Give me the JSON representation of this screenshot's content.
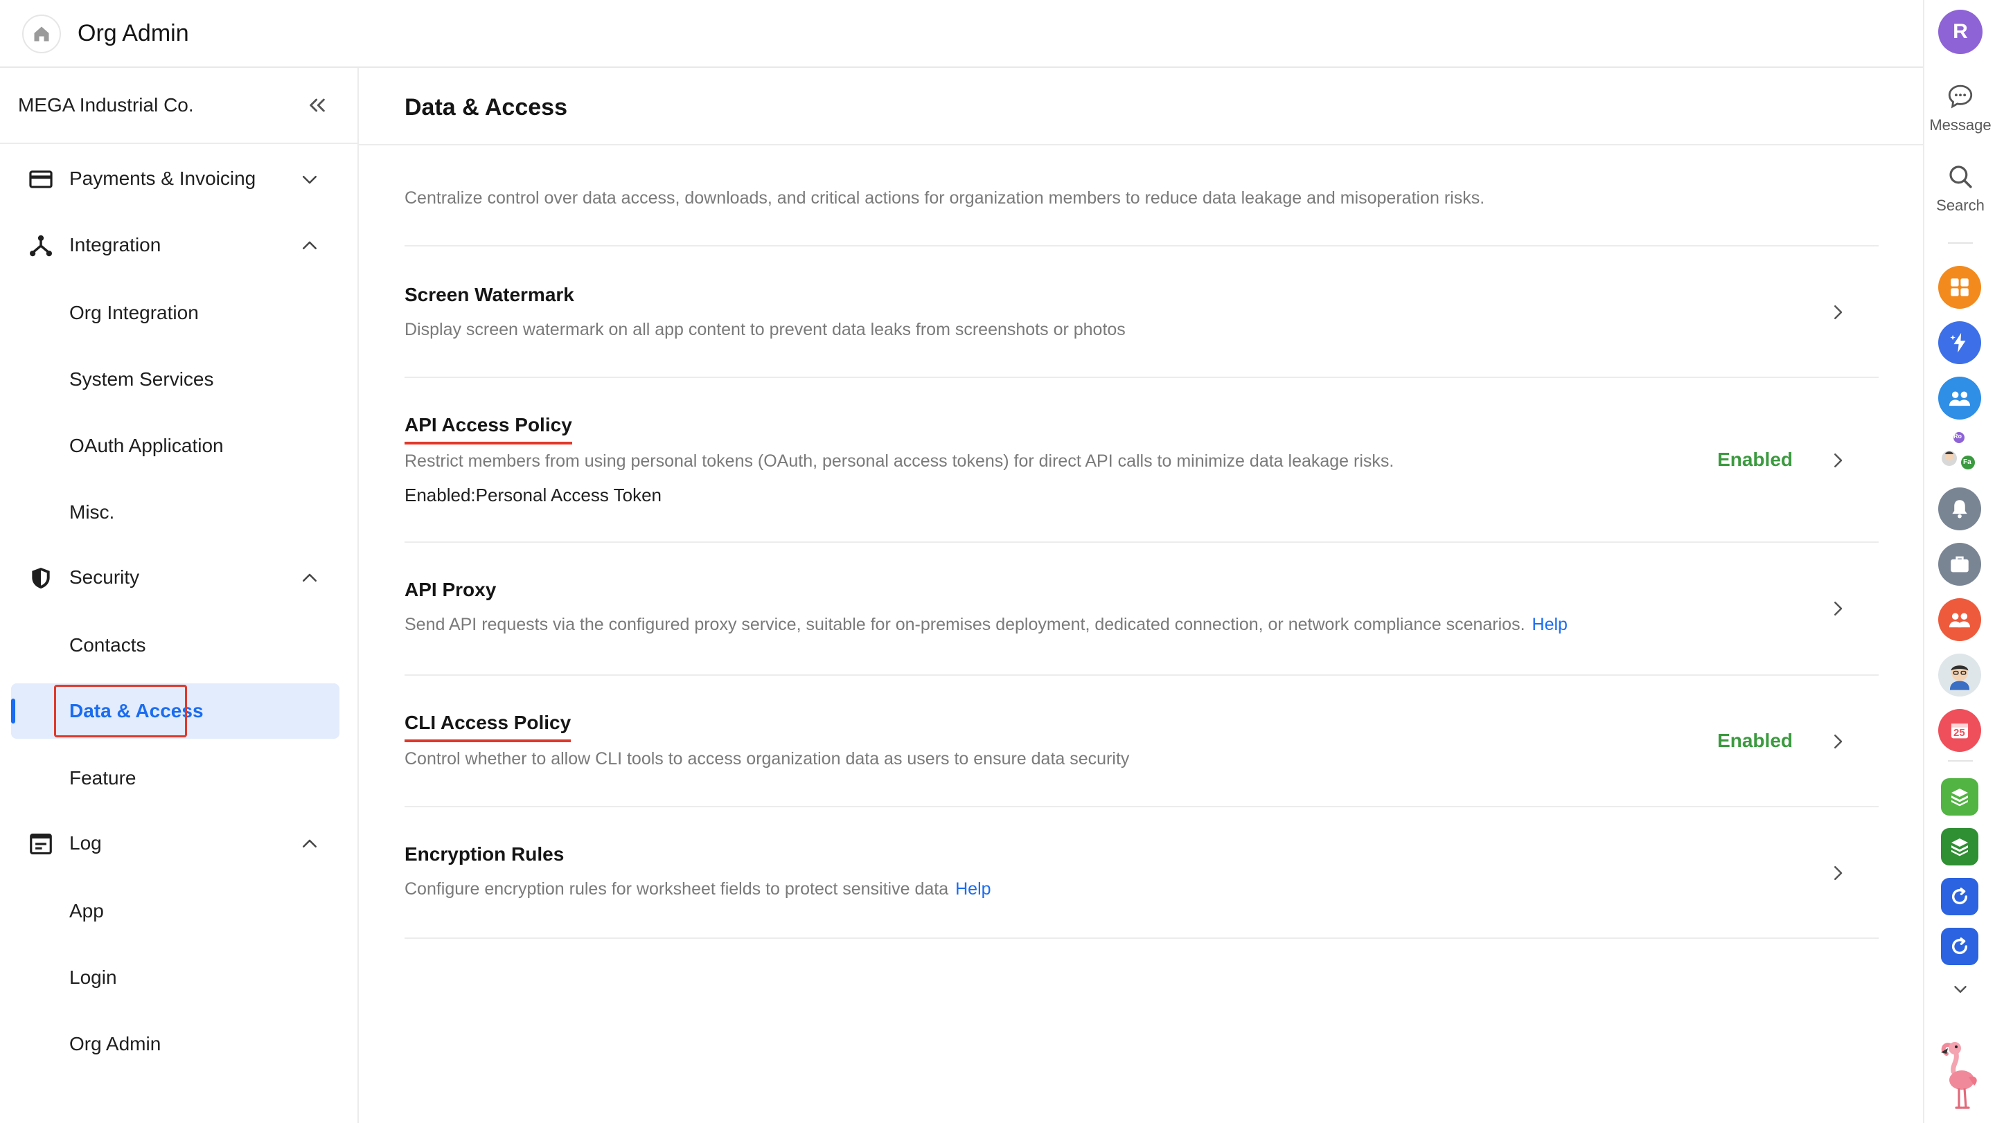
{
  "header": {
    "title": "Org Admin",
    "home_icon": "home-icon"
  },
  "sidebar": {
    "org_name": "MEGA Industrial Co.",
    "collapse_icon": "double-chevron-left-icon",
    "groups": [
      {
        "label": "Payments & Invoicing",
        "icon": "credit-card-icon",
        "expanded": false,
        "items": []
      },
      {
        "label": "Integration",
        "icon": "integration-icon",
        "expanded": true,
        "items": [
          {
            "label": "Org Integration"
          },
          {
            "label": "System Services"
          },
          {
            "label": "OAuth Application"
          },
          {
            "label": "Misc."
          }
        ]
      },
      {
        "label": "Security",
        "icon": "shield-icon",
        "expanded": true,
        "items": [
          {
            "label": "Contacts"
          },
          {
            "label": "Data & Access",
            "active": true
          },
          {
            "label": "Feature"
          }
        ]
      },
      {
        "label": "Log",
        "icon": "log-icon",
        "expanded": true,
        "items": [
          {
            "label": "App"
          },
          {
            "label": "Login"
          },
          {
            "label": "Org Admin"
          }
        ]
      }
    ]
  },
  "main": {
    "title": "Data & Access",
    "description": "Centralize control over data access, downloads, and critical actions for organization members to reduce data leakage and misoperation risks.",
    "rows": [
      {
        "title": "Screen Watermark",
        "description": "Display screen watermark on all app content to prevent data leaks from screenshots or photos",
        "status": "",
        "extra": "",
        "help": ""
      },
      {
        "title": "API Access Policy",
        "description": "Restrict members from using personal tokens (OAuth, personal access tokens) for direct API calls to minimize data leakage risks.",
        "status": "Enabled",
        "extra": "Enabled:Personal Access Token",
        "help": ""
      },
      {
        "title": "API Proxy",
        "description": "Send API requests via the configured proxy service, suitable for on-premises deployment, dedicated connection, or network compliance scenarios.",
        "status": "",
        "extra": "",
        "help": "Help"
      },
      {
        "title": "CLI Access Policy",
        "description": "Control whether to allow CLI tools to access organization data as users to ensure data security",
        "status": "Enabled",
        "extra": "",
        "help": ""
      },
      {
        "title": "Encryption Rules",
        "description": "Configure encryption rules for worksheet fields to protect sensitive data",
        "status": "",
        "extra": "",
        "help": "Help"
      }
    ]
  },
  "rail": {
    "avatar_initial": "R",
    "message_label": "Message",
    "search_label": "Search",
    "calendar_day": "25",
    "group_avatar_a": "Ro",
    "group_avatar_b": "Fa"
  },
  "colors": {
    "accent": "#1a6cf0",
    "active_bg": "#e2ecfd",
    "enabled": "#3b9a3f",
    "highlight": "#e0392b",
    "avatar": "#8e63d6"
  }
}
